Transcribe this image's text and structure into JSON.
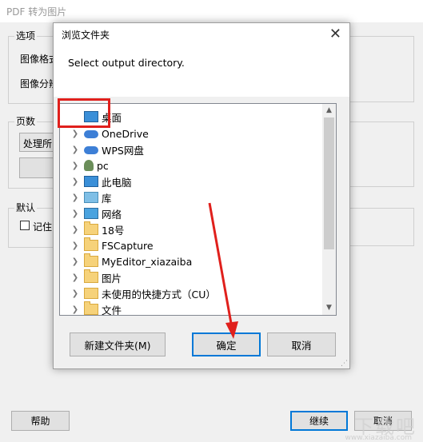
{
  "background_window": {
    "title": "PDF 转为图片",
    "groups": {
      "options": {
        "label": "选项",
        "rows": [
          "图像格式",
          "图像分辨"
        ]
      },
      "pages": {
        "label": "页数",
        "select_value": "处理所"
      },
      "defaults": {
        "label": "默认",
        "checkbox_label": "记住"
      }
    },
    "buttons": {
      "help": "帮助",
      "continue": "继续",
      "cancel": "取消"
    }
  },
  "dialog": {
    "title": "浏览文件夹",
    "prompt": "Select output directory.",
    "tree": [
      {
        "label": "桌面",
        "icon": "monitor-icon",
        "selected": true,
        "has_children": false
      },
      {
        "label": "OneDrive",
        "icon": "cloud-icon",
        "has_children": true
      },
      {
        "label": "WPS网盘",
        "icon": "cloud-icon",
        "has_children": true
      },
      {
        "label": "pc",
        "icon": "user-icon",
        "has_children": true
      },
      {
        "label": "此电脑",
        "icon": "computer-icon",
        "has_children": true
      },
      {
        "label": "库",
        "icon": "library-icon",
        "has_children": true
      },
      {
        "label": "网络",
        "icon": "network-icon",
        "has_children": true
      },
      {
        "label": "18号",
        "icon": "folder-icon",
        "has_children": true
      },
      {
        "label": "FSCapture",
        "icon": "folder-icon",
        "has_children": true
      },
      {
        "label": "MyEditor_xiazaiba",
        "icon": "folder-icon",
        "has_children": true
      },
      {
        "label": "图片",
        "icon": "folder-icon",
        "has_children": true
      },
      {
        "label": "未使用的快捷方式（CU）",
        "icon": "shortcut-folder-icon",
        "has_children": true
      },
      {
        "label": "文件",
        "icon": "folder-icon",
        "has_children": true
      }
    ],
    "buttons": {
      "new_folder": "新建文件夹(M)",
      "ok": "确定",
      "cancel": "取消"
    }
  },
  "watermark": {
    "text": "下载吧",
    "url_text": "www.xiazaiba.com"
  },
  "colors": {
    "highlight_box": "#e0201c",
    "arrow": "#e0201c",
    "accent": "#0078d7"
  }
}
